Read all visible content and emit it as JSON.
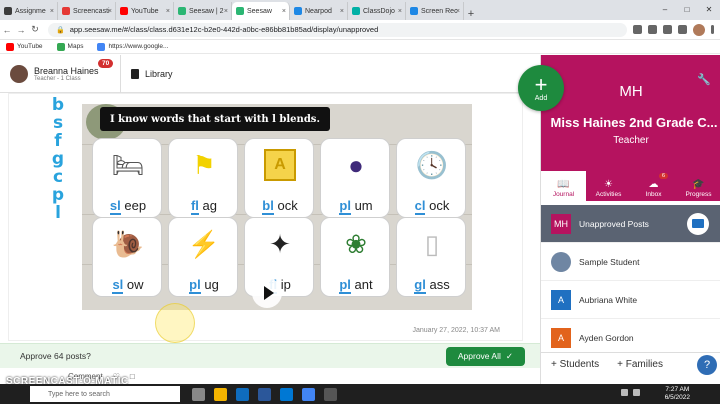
{
  "tabs": [
    {
      "label": "Assignme",
      "color": "#3c3c3c"
    },
    {
      "label": "Screencasti",
      "color": "#e53935"
    },
    {
      "label": "YouTube",
      "color": "#ff0000"
    },
    {
      "label": "Seesaw | 2",
      "color": "#2bb673"
    },
    {
      "label": "Seesaw",
      "color": "#2bb673",
      "active": true
    },
    {
      "label": "Nearpod",
      "color": "#1e88e5"
    },
    {
      "label": "ClassDojo",
      "color": "#00b0a6"
    },
    {
      "label": "Screen Rec",
      "color": "#1e88e5"
    }
  ],
  "address": {
    "url": "app.seesaw.me/#/class/class.d631e12c-b2e0-442d-a0bc-e86bb81b85ad/display/unapproved"
  },
  "bookmarks": [
    {
      "label": "YouTube",
      "color": "#ff0000"
    },
    {
      "label": "Maps",
      "color": "#34a853"
    },
    {
      "label": "https://www.google...",
      "color": "#4285f4"
    }
  ],
  "header": {
    "teacher_name": "Breanna Haines",
    "teacher_sub": "Teacher - 1 Class",
    "notif_count": "70",
    "library_label": "Library"
  },
  "post": {
    "letters": [
      "b",
      "s",
      "f",
      "g",
      "c",
      "p",
      "l"
    ],
    "banner": "I know words that start with l blends.",
    "cards": [
      {
        "blend": "sl",
        "rest": "eep",
        "icon": "sleep-icon"
      },
      {
        "blend": "fl",
        "rest": "ag",
        "icon": "flag-icon"
      },
      {
        "blend": "bl",
        "rest": "ock",
        "icon": "block-icon"
      },
      {
        "blend": "pl",
        "rest": "um",
        "icon": "plum-icon"
      },
      {
        "blend": "cl",
        "rest": "ock",
        "icon": "clock-icon"
      },
      {
        "blend": "sl",
        "rest": "ow",
        "icon": "snail-icon"
      },
      {
        "blend": "pl",
        "rest": "ug",
        "icon": "plug-icon"
      },
      {
        "blend": "fl",
        "rest": "ip",
        "icon": "flip-icon"
      },
      {
        "blend": "pl",
        "rest": "ant",
        "icon": "plant-icon"
      },
      {
        "blend": "gl",
        "rest": "ass",
        "icon": "glass-icon"
      }
    ],
    "block_letter": "A",
    "date": "January 27, 2022, 10:37 AM"
  },
  "approve": {
    "text": "Approve 64 posts?",
    "button": "Approve All",
    "check": "✓"
  },
  "comment": {
    "label": "Comment"
  },
  "watermark": {
    "line1": "RECORDED WITH",
    "line2": "SCREENCAST-O-MATIC"
  },
  "sidebar": {
    "add_label": "Add",
    "initials": "MH",
    "class_name": "Miss Haines 2nd Grade C...",
    "role": "Teacher",
    "tabs": [
      {
        "label": "Journal",
        "icon": "book-icon"
      },
      {
        "label": "Activities",
        "icon": "bulb-icon"
      },
      {
        "label": "Inbox",
        "icon": "chat-icon",
        "badge": "6"
      },
      {
        "label": "Progress",
        "icon": "cap-icon"
      }
    ],
    "items": [
      {
        "label": "Unapproved Posts",
        "initial": "MH",
        "color": "#b5135f"
      },
      {
        "label": "Sample Student",
        "initial": "",
        "color": "#6f86a3"
      },
      {
        "label": "Aubriana White",
        "initial": "A",
        "color": "#1f70c1"
      },
      {
        "label": "Ayden Gordon",
        "initial": "A",
        "color": "#e2631c"
      }
    ],
    "students_label": "Students",
    "families_label": "Families",
    "help": "?"
  },
  "taskbar": {
    "search_placeholder": "Type here to search",
    "time": "7:27 AM",
    "date": "6/5/2022"
  }
}
